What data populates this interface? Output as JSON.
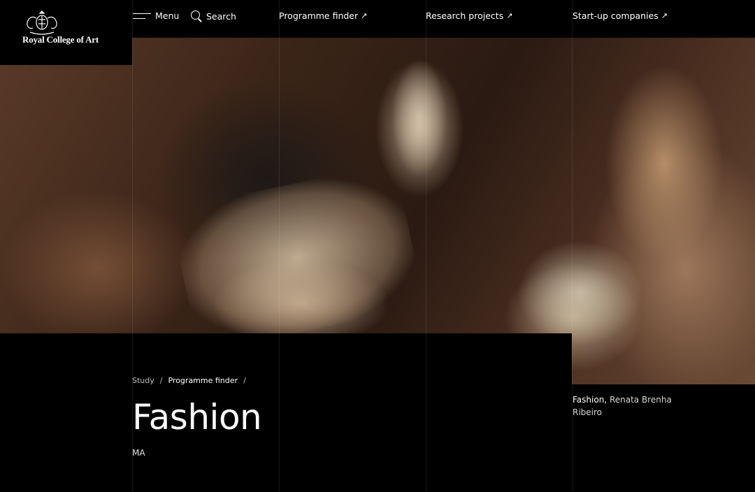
{
  "header": {
    "logo_text": "Royal College of Art",
    "menu_label": "Menu",
    "search_label": "Search",
    "nav_links": [
      {
        "label": "Programme finder",
        "icon": "external-arrow-icon"
      },
      {
        "label": "Research projects",
        "icon": "external-arrow-icon"
      },
      {
        "label": "Start-up companies",
        "icon": "external-arrow-icon"
      }
    ],
    "arrow_glyph": "↗"
  },
  "breadcrumb": {
    "items": [
      "Study",
      "Programme finder"
    ],
    "separator": "/"
  },
  "main": {
    "title": "Fashion",
    "degree": "MA"
  },
  "hero_caption": {
    "title": "Fashion,",
    "credit": "Renata Brenha Ribeiro"
  },
  "colors": {
    "background": "#000000",
    "text": "#ffffff"
  }
}
